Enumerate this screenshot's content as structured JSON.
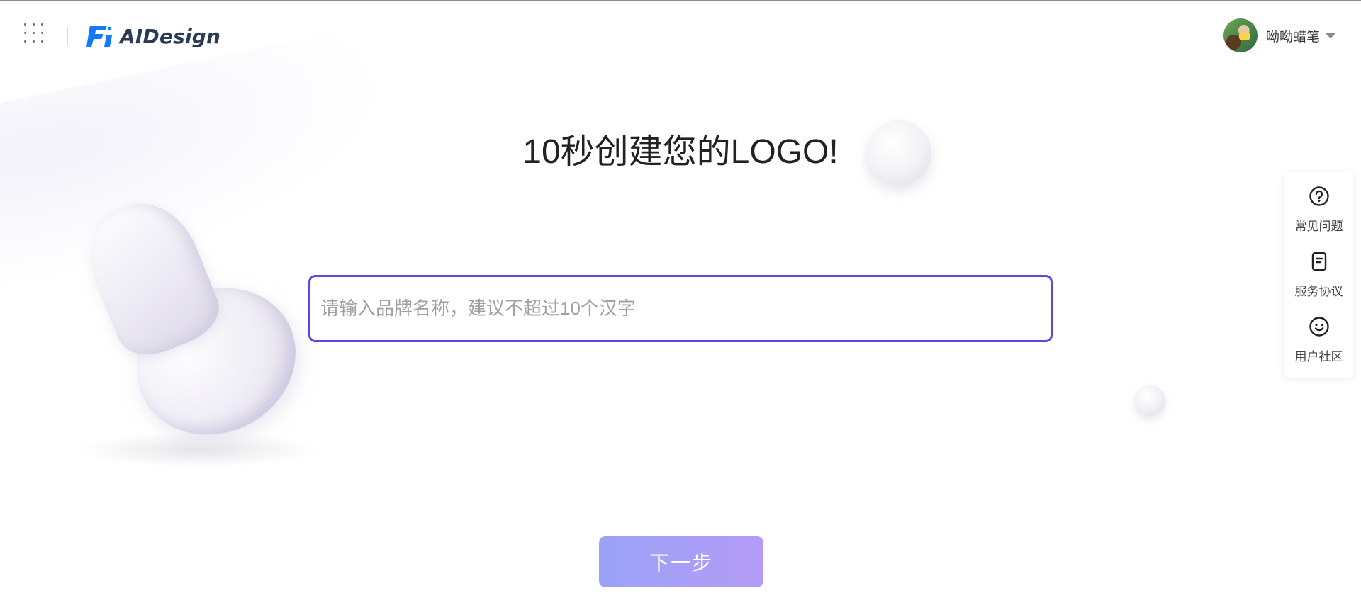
{
  "header": {
    "brand_name": "AIDesign",
    "user": {
      "name": "呦呦蜡笔"
    }
  },
  "main": {
    "title": "10秒创建您的LOGO!",
    "brand_input": {
      "placeholder": "请输入品牌名称，建议不超过10个汉字",
      "value": ""
    },
    "next_button_label": "下一步"
  },
  "side_panel": {
    "items": [
      {
        "label": "常见问题",
        "icon": "question-circle-icon"
      },
      {
        "label": "服务协议",
        "icon": "document-icon"
      },
      {
        "label": "用户社区",
        "icon": "smile-icon"
      }
    ]
  },
  "colors": {
    "accent": "#5b47e8",
    "button_gradient_start": "#9ba3f7",
    "button_gradient_end": "#b49bf7",
    "logo_blue": "#1677ff"
  }
}
